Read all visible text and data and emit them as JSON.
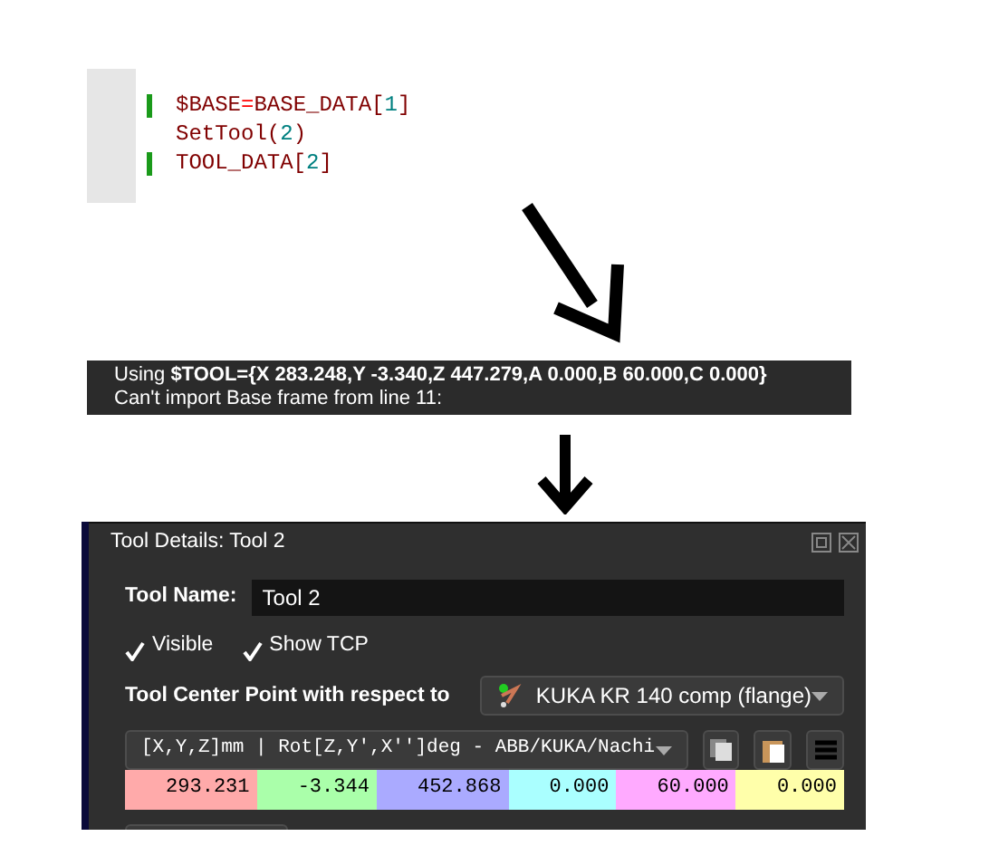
{
  "code_editor": {
    "lines": [
      {
        "marked": true,
        "tokens": [
          {
            "text": "$BASE",
            "kind": "name"
          },
          {
            "text": "=",
            "kind": "op"
          },
          {
            "text": "BASE_DATA[",
            "kind": "name"
          },
          {
            "text": "1",
            "kind": "num"
          },
          {
            "text": "]",
            "kind": "name"
          }
        ]
      },
      {
        "marked": false,
        "tokens": [
          {
            "text": "SetTool(",
            "kind": "name"
          },
          {
            "text": "2",
            "kind": "num"
          },
          {
            "text": ")",
            "kind": "name"
          }
        ]
      },
      {
        "marked": true,
        "tokens": [
          {
            "text": "TOOL_DATA[",
            "kind": "name"
          },
          {
            "text": "2",
            "kind": "num"
          },
          {
            "text": "]",
            "kind": "name"
          }
        ]
      }
    ]
  },
  "log": {
    "lines": [
      "Using **$TOOL={X 283.248,Y -3.340,Z 447.279,A 0.000,B 60.000,C 0.000}**",
      "Can't import Base frame from line 11:"
    ]
  },
  "tool_details": {
    "title": "Tool Details: Tool 2",
    "name_label": "Tool Name:",
    "name_value": "Tool 2",
    "checkboxes": [
      {
        "label": "Visible",
        "checked": true
      },
      {
        "label": "Show TCP",
        "checked": true
      }
    ],
    "reference_label": "Tool Center Point with respect to",
    "reference_value": "KUKA KR 140 comp (flange)",
    "format_value": "[X,Y,Z]mm | Rot[Z,Y',X'']deg - ABB/KUKA/Nachi",
    "values": [
      {
        "text": "293.231",
        "color": "#ffaaaa"
      },
      {
        "text": "-3.344",
        "color": "#aaffaa"
      },
      {
        "text": "452.868",
        "color": "#aaaaff"
      },
      {
        "text": "0.000",
        "color": "#aaffff"
      },
      {
        "text": "60.000",
        "color": "#ffaaff"
      },
      {
        "text": "0.000",
        "color": "#ffffaa"
      }
    ]
  }
}
